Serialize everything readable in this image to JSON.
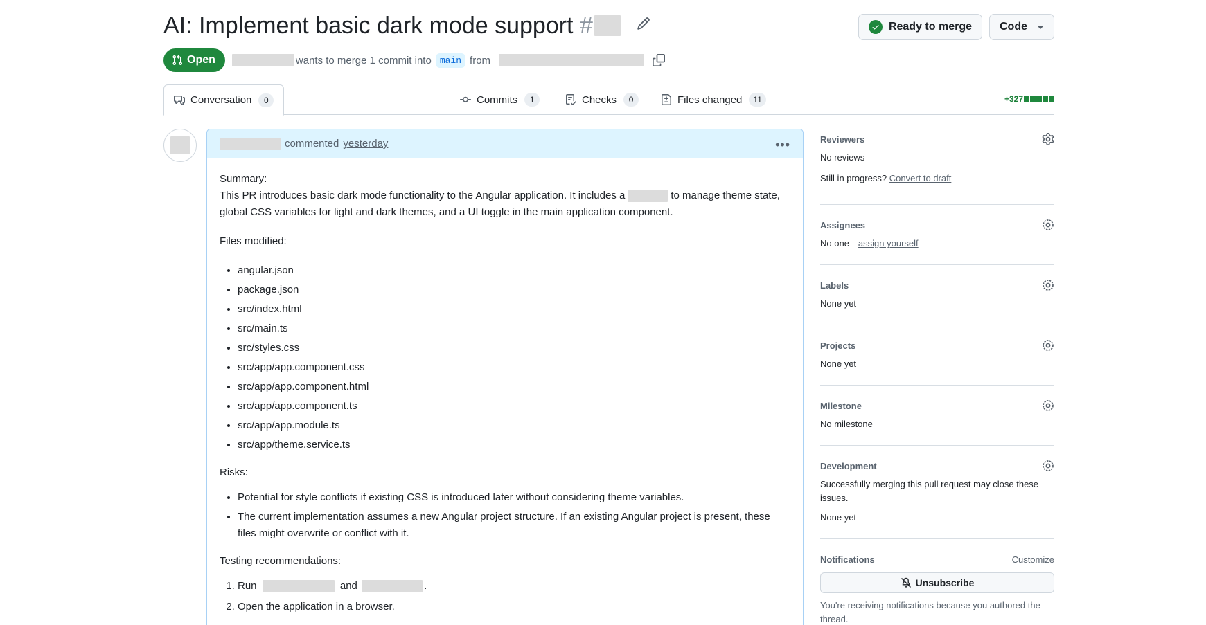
{
  "header": {
    "title": "AI: Implement basic dark mode support",
    "number_prefix": "#",
    "merge_button": "Ready to merge",
    "code_button": "Code"
  },
  "state": {
    "badge": "Open",
    "merge_text": "wants to merge 1 commit into",
    "base_branch": "main",
    "from_text": "from"
  },
  "tabs": [
    {
      "label": "Conversation",
      "count": "0"
    },
    {
      "label": "Commits",
      "count": "1"
    },
    {
      "label": "Checks",
      "count": "0"
    },
    {
      "label": "Files changed",
      "count": "11"
    }
  ],
  "diffstat": {
    "additions": "+327"
  },
  "comment": {
    "action": "commented",
    "time": "yesterday",
    "summary_heading": "Summary:",
    "summary_part1": "This PR introduces basic dark mode functionality to the Angular application. It includes a",
    "summary_part2": "to manage theme state, global CSS variables for light and dark themes, and a UI toggle in the main application component.",
    "files_heading": "Files modified:",
    "files": [
      "angular.json",
      "package.json",
      "src/index.html",
      "src/main.ts",
      "src/styles.css",
      "src/app/app.component.css",
      "src/app/app.component.html",
      "src/app/app.component.ts",
      "src/app/app.module.ts",
      "src/app/theme.service.ts"
    ],
    "risks_heading": "Risks:",
    "risks": [
      "Potential for style conflicts if existing CSS is introduced later without considering theme variables.",
      "The current implementation assumes a new Angular project structure. If an existing Angular project is present, these files might overwrite or conflict with it."
    ],
    "testing_heading": "Testing recommendations:",
    "testing_step1_run": "Run",
    "testing_step1_and": "and",
    "testing_step1_end": ".",
    "testing_step2": "Open the application in a browser."
  },
  "sidebar": {
    "reviewers": {
      "title": "Reviewers",
      "value": "No reviews",
      "progress_text": "Still in progress?",
      "progress_link": "Convert to draft"
    },
    "assignees": {
      "title": "Assignees",
      "value": "No one—",
      "link": "assign yourself"
    },
    "labels": {
      "title": "Labels",
      "value": "None yet"
    },
    "projects": {
      "title": "Projects",
      "value": "None yet"
    },
    "milestone": {
      "title": "Milestone",
      "value": "No milestone"
    },
    "development": {
      "title": "Development",
      "description": "Successfully merging this pull request may close these issues.",
      "value": "None yet"
    },
    "notifications": {
      "title": "Notifications",
      "customize": "Customize",
      "button": "Unsubscribe",
      "note": "You're receiving notifications because you authored the thread."
    }
  }
}
